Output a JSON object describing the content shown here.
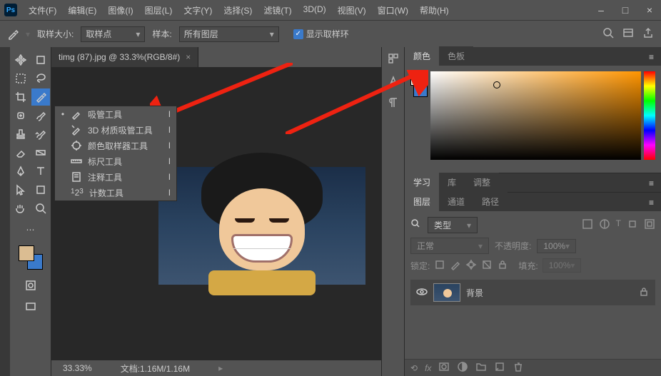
{
  "app": {
    "logo": "Ps"
  },
  "menu": [
    "文件(F)",
    "编辑(E)",
    "图像(I)",
    "图层(L)",
    "文字(Y)",
    "选择(S)",
    "滤镜(T)",
    "3D(D)",
    "视图(V)",
    "窗口(W)",
    "帮助(H)"
  ],
  "win": {
    "min": "–",
    "max": "□",
    "close": "×"
  },
  "options": {
    "sample_size_label": "取样大小:",
    "sample_size_value": "取样点",
    "sample_label": "样本:",
    "sample_value": "所有图层",
    "show_ring": "显示取样环"
  },
  "doc": {
    "tab": "timg (87).jpg @ 33.3%(RGB/8#)",
    "zoom": "33.33%",
    "docsize": "文档:1.16M/1.16M"
  },
  "flyout": [
    {
      "active": true,
      "icon": "eyedropper",
      "label": "吸管工具",
      "key": "I"
    },
    {
      "active": false,
      "icon": "eyedropper-3d",
      "label": "3D 材质吸管工具",
      "key": "I"
    },
    {
      "active": false,
      "icon": "color-sampler",
      "label": "颜色取样器工具",
      "key": "I"
    },
    {
      "active": false,
      "icon": "ruler",
      "label": "标尺工具",
      "key": "I"
    },
    {
      "active": false,
      "icon": "note",
      "label": "注释工具",
      "key": "I"
    },
    {
      "active": false,
      "icon": "count",
      "label": "计数工具",
      "key": "I"
    }
  ],
  "panels": {
    "color": {
      "tabs": [
        "颜色",
        "色板"
      ]
    },
    "study": {
      "tabs": [
        "学习",
        "库",
        "调整"
      ]
    },
    "layers": {
      "tabs": [
        "图层",
        "通道",
        "路径"
      ],
      "kind": "类型",
      "blend": "正常",
      "opacity_label": "不透明度:",
      "opacity": "100%",
      "lock_label": "锁定:",
      "fill_label": "填充:",
      "fill": "100%",
      "layer_name": "背景"
    }
  },
  "colors": {
    "fg": "#dbbd92",
    "bg": "#3a7acb"
  }
}
